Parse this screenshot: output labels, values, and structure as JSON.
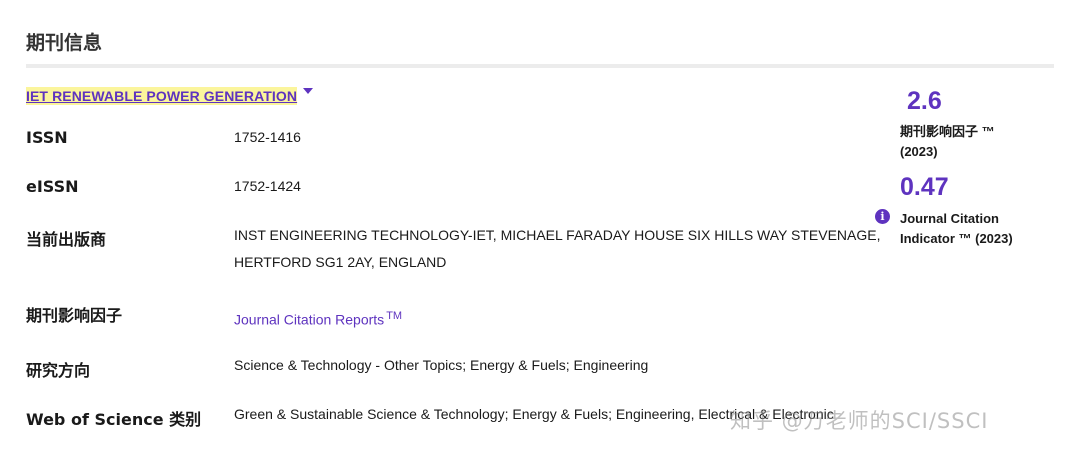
{
  "section": {
    "title": "期刊信息"
  },
  "journal": {
    "title": "IET RENEWABLE POWER GENERATION"
  },
  "rows": [
    {
      "label": "ISSN",
      "value": "1752-1416"
    },
    {
      "label": "eISSN",
      "value": "1752-1424"
    },
    {
      "label": "当前出版商",
      "value_line1": "INST ENGINEERING TECHNOLOGY-IET, MICHAEL FARADAY HOUSE SIX HILLS WAY STEVENAGE,",
      "value_line2": "HERTFORD SG1 2AY, ENGLAND"
    },
    {
      "label": "期刊影响因子",
      "value": "Journal Citation Reports",
      "tm": "TM"
    },
    {
      "label": "研究方向",
      "value": "Science & Technology - Other Topics; Energy & Fuels; Engineering"
    },
    {
      "label": "Web of Science 类别",
      "value": "Green & Sustainable Science & Technology; Energy & Fuels; Engineering, Electrical & Electronic"
    }
  ],
  "metrics": {
    "impact_factor": {
      "value": "2.6",
      "label_line1": "期刊影响因子 ™",
      "label_line2": "(2023)"
    },
    "jci": {
      "value": "0.47",
      "label_line1": "Journal Citation",
      "label_line2": "Indicator ™ (2023)",
      "info_icon": "info-icon"
    }
  },
  "watermark": {
    "text": "知乎 @万老师的SCI/SSCI"
  },
  "colors": {
    "accent": "#5e33bf",
    "highlight": "#fbf59c",
    "divider": "#ececec"
  }
}
